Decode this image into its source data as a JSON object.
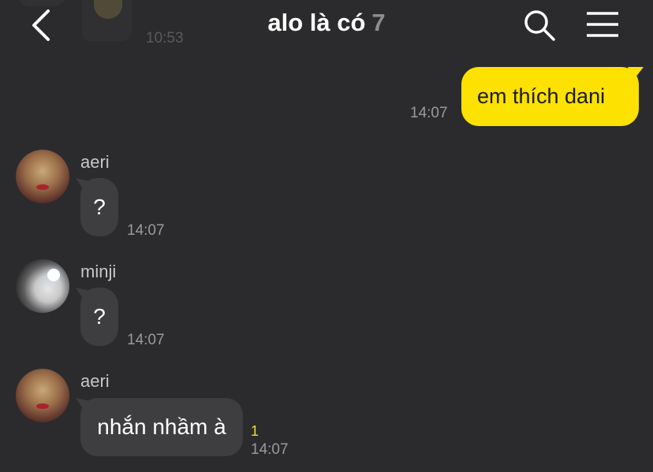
{
  "header": {
    "title": "alo là có",
    "member_count": "7",
    "back_icon": "chevron-left-icon",
    "search_icon": "search-icon",
    "menu_icon": "hamburger-menu-icon"
  },
  "previous_message": {
    "time": "10:53"
  },
  "messages": [
    {
      "sender": "me",
      "text": "em thích dani",
      "time": "14:07"
    },
    {
      "sender": "aeri",
      "text": "?",
      "time": "14:07"
    },
    {
      "sender": "minji",
      "text": "?",
      "time": "14:07"
    },
    {
      "sender": "aeri",
      "text": "nhắn nhầm à",
      "time": "14:07",
      "unread_count": "1"
    }
  ],
  "colors": {
    "background": "#2b2b2d",
    "my_bubble": "#fde100",
    "other_bubble": "#3e3e40",
    "unread": "#f2dc38"
  }
}
